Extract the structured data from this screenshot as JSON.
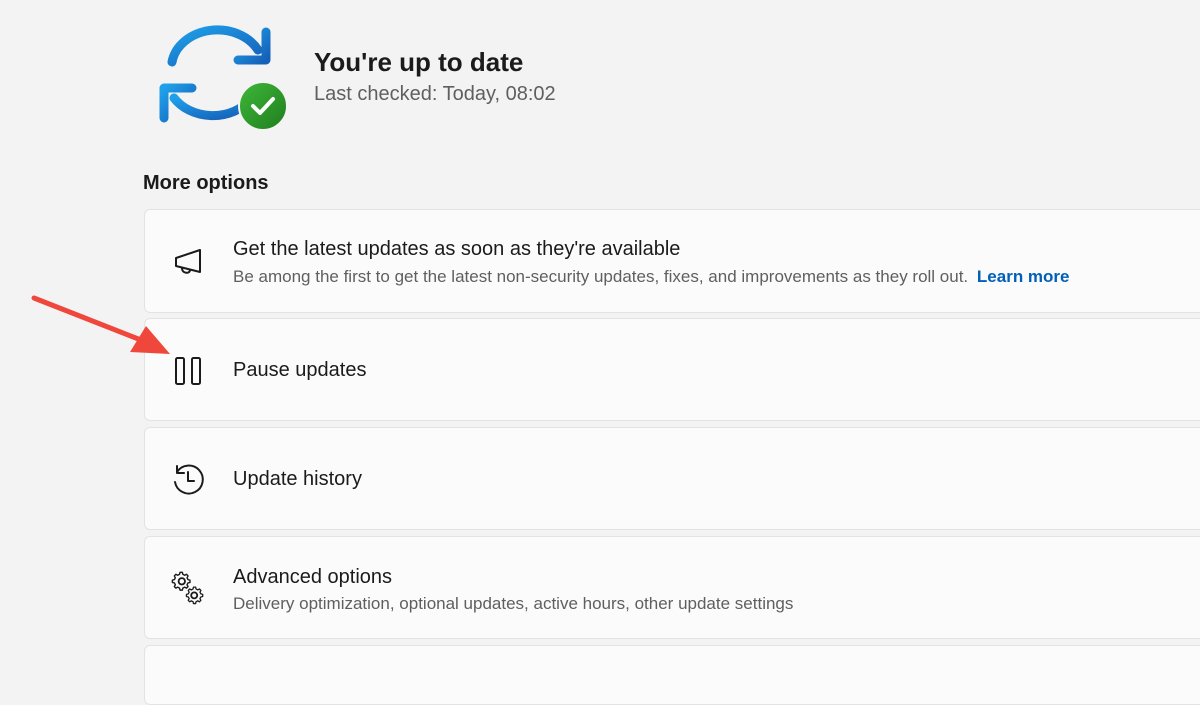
{
  "status": {
    "title": "You're up to date",
    "last_checked": "Last checked: Today, 08:02",
    "icon": "sync-check-icon"
  },
  "more_options": {
    "title": "More options",
    "items": [
      {
        "icon": "megaphone-icon",
        "title": "Get the latest updates as soon as they're available",
        "description": "Be among the first to get the latest non-security updates, fixes, and improvements as they roll out.",
        "link": "Learn more"
      },
      {
        "icon": "pause-icon",
        "title": "Pause updates"
      },
      {
        "icon": "history-icon",
        "title": "Update history"
      },
      {
        "icon": "gears-icon",
        "title": "Advanced options",
        "description": "Delivery optimization, optional updates, active hours, other update settings"
      }
    ]
  },
  "colors": {
    "background": "#f3f3f3",
    "card": "#fbfbfb",
    "link": "#005fb8",
    "sync_blue": "#1a8ad8",
    "check_green": "#2a9d28",
    "annotation_arrow": "#f0473c"
  }
}
